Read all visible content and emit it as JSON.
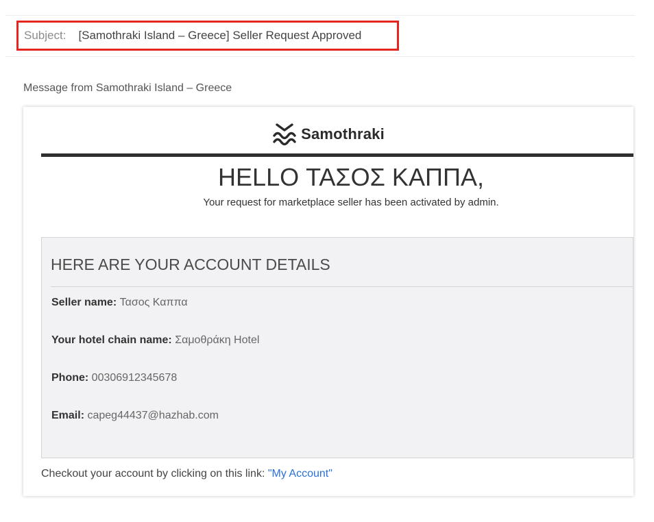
{
  "subject": {
    "label": "Subject:",
    "text": "[Samothraki Island – Greece] Seller Request Approved"
  },
  "message_from": "Message from Samothraki Island – Greece",
  "email": {
    "logo": {
      "icon": "samothraki-wave-logo-icon",
      "text": "Samothraki"
    },
    "greeting": "HELLO ΤΑΣΟΣ ΚΑΠΠΑ,",
    "greeting_sub": "Your request for marketplace seller has been activated by admin.",
    "details": {
      "title": "HERE ARE YOUR ACCOUNT DETAILS",
      "rows": [
        {
          "label": "Seller name:",
          "value": "Τασος Καππα"
        },
        {
          "label": "Your hotel chain name:",
          "value": "Σαμοθράκη Hotel"
        },
        {
          "label": "Phone:",
          "value": "00306912345678"
        },
        {
          "label": "Email:",
          "value": "capeg44437@hazhab.com"
        }
      ]
    },
    "checkout_text": "Checkout your account by clicking on this link:",
    "link_text": "\"My Account\""
  },
  "colors": {
    "highlight_border": "#e5261f",
    "link": "#2a6fdb",
    "details_bg": "#f2f2f4",
    "dark_bar": "#2f2f2f"
  }
}
